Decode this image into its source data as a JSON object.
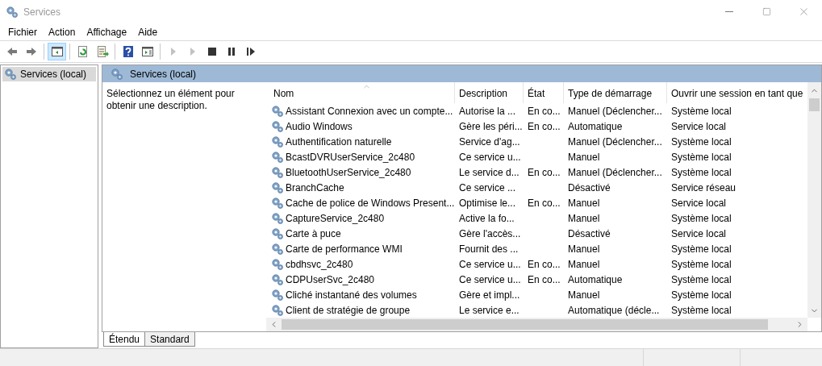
{
  "window": {
    "title": "Services"
  },
  "menu": [
    "Fichier",
    "Action",
    "Affichage",
    "Aide"
  ],
  "toolbar": [
    {
      "kind": "back",
      "active": false,
      "disabled": false
    },
    {
      "kind": "forward",
      "active": false,
      "disabled": false
    },
    {
      "kind": "sep"
    },
    {
      "kind": "tree",
      "active": true,
      "disabled": false
    },
    {
      "kind": "sep"
    },
    {
      "kind": "refresh",
      "active": false,
      "disabled": false
    },
    {
      "kind": "export",
      "active": false,
      "disabled": false
    },
    {
      "kind": "sep"
    },
    {
      "kind": "help",
      "active": false,
      "disabled": false
    },
    {
      "kind": "pane",
      "active": false,
      "disabled": false
    },
    {
      "kind": "sep"
    },
    {
      "kind": "play",
      "active": false,
      "disabled": true
    },
    {
      "kind": "play",
      "active": false,
      "disabled": true
    },
    {
      "kind": "stop",
      "active": false,
      "disabled": false
    },
    {
      "kind": "pause",
      "active": false,
      "disabled": false
    },
    {
      "kind": "resume",
      "active": false,
      "disabled": false
    }
  ],
  "tree": {
    "items": [
      {
        "label": "Services (local)",
        "selected": true
      }
    ]
  },
  "panel": {
    "title": "Services (local)",
    "description": "Sélectionnez un élément pour obtenir une description."
  },
  "table": {
    "columns": [
      {
        "label": "Nom",
        "sorted": true
      },
      {
        "label": "Description",
        "sorted": false
      },
      {
        "label": "État",
        "sorted": false
      },
      {
        "label": "Type de démarrage",
        "sorted": false
      },
      {
        "label": "Ouvrir une session en tant que",
        "sorted": false
      }
    ],
    "rows": [
      [
        "Assistant Connexion avec un compte...",
        "Autorise la ...",
        "En co...",
        "Manuel (Déclencher...",
        "Système local"
      ],
      [
        "Audio Windows",
        "Gère les péri...",
        "En co...",
        "Automatique",
        "Service local"
      ],
      [
        "Authentification naturelle",
        "Service d'ag...",
        "",
        "Manuel (Déclencher...",
        "Système local"
      ],
      [
        "BcastDVRUserService_2c480",
        "Ce service u...",
        "",
        "Manuel",
        "Système local"
      ],
      [
        "BluetoothUserService_2c480",
        "Le service d...",
        "En co...",
        "Manuel (Déclencher...",
        "Système local"
      ],
      [
        "BranchCache",
        "Ce service ...",
        "",
        "Désactivé",
        "Service réseau"
      ],
      [
        "Cache de police de Windows Present...",
        "Optimise le...",
        "En co...",
        "Manuel",
        "Service local"
      ],
      [
        "CaptureService_2c480",
        "Active la fo...",
        "",
        "Manuel",
        "Système local"
      ],
      [
        "Carte à puce",
        "Gère l'accès...",
        "",
        "Désactivé",
        "Service local"
      ],
      [
        "Carte de performance WMI",
        "Fournit des ...",
        "",
        "Manuel",
        "Système local"
      ],
      [
        "cbdhsvc_2c480",
        "Ce service u...",
        "En co...",
        "Manuel",
        "Système local"
      ],
      [
        "CDPUserSvc_2c480",
        "Ce service u...",
        "En co...",
        "Automatique",
        "Système local"
      ],
      [
        "Cliché instantané des volumes",
        "Gère et impl...",
        "",
        "Manuel",
        "Système local"
      ],
      [
        "Client de stratégie de groupe",
        "Le service e...",
        "",
        "Automatique (décle...",
        "Système local"
      ]
    ]
  },
  "tabs": [
    {
      "label": "Étendu",
      "selected": true
    },
    {
      "label": "Standard",
      "selected": false
    }
  ]
}
